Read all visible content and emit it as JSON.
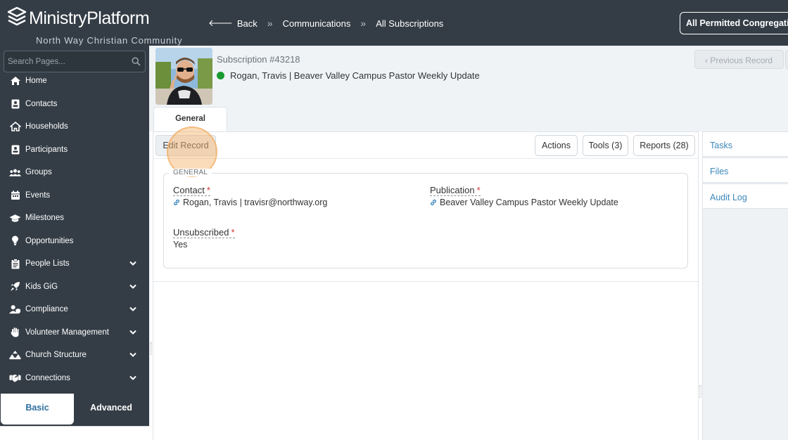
{
  "app": {
    "title": "MinistryPlatform",
    "subtitle": "North Way Christian Community"
  },
  "header": {
    "back_label": "Back",
    "breadcrumbs": [
      "Communications",
      "All Subscriptions"
    ],
    "congregation_label": "All Permitted Congregations"
  },
  "sidebar": {
    "search_placeholder": "Search Pages...",
    "items": [
      {
        "label": "Home",
        "icon": "home-icon"
      },
      {
        "label": "Contacts",
        "icon": "contact-card-icon"
      },
      {
        "label": "Households",
        "icon": "house-icon"
      },
      {
        "label": "Participants",
        "icon": "participant-card-icon"
      },
      {
        "label": "Groups",
        "icon": "users-icon"
      },
      {
        "label": "Events",
        "icon": "calendar-icon"
      },
      {
        "label": "Milestones",
        "icon": "graduation-cap-icon"
      },
      {
        "label": "Opportunities",
        "icon": "lightbulb-icon"
      },
      {
        "label": "People Lists",
        "icon": "clipboard-icon",
        "expandable": true
      },
      {
        "label": "Kids GiG",
        "icon": "rocket-icon",
        "expandable": true
      },
      {
        "label": "Compliance",
        "icon": "user-shield-icon",
        "expandable": true
      },
      {
        "label": "Volunteer Management",
        "icon": "hand-icon",
        "expandable": true
      },
      {
        "label": "Church Structure",
        "icon": "sitemap-icon",
        "expandable": true
      },
      {
        "label": "Connections",
        "icon": "handshake-icon",
        "expandable": true
      }
    ],
    "mode_basic": "Basic",
    "mode_advanced": "Advanced"
  },
  "record": {
    "id_label": "Subscription #43218",
    "title": "Rogan, Travis | Beaver Valley Campus Pastor Weekly Update",
    "status_color": "#1a9b2f",
    "prev_label": "Previous Record",
    "tab_general": "General"
  },
  "toolbar": {
    "edit_label": "Edit Record",
    "actions_label": "Actions",
    "tools_label": "Tools (3)",
    "reports_label": "Reports (28)"
  },
  "form": {
    "legend": "GENERAL",
    "contact_label": "Contact",
    "contact_value": "Rogan, Travis | travisr@northway.org",
    "publication_label": "Publication",
    "publication_value": "Beaver Valley Campus Pastor Weekly Update",
    "unsubscribed_label": "Unsubscribed",
    "unsubscribed_value": "Yes",
    "required_mark": "*"
  },
  "right_panel": {
    "items": [
      "Tasks",
      "Files",
      "Audit Log"
    ]
  }
}
